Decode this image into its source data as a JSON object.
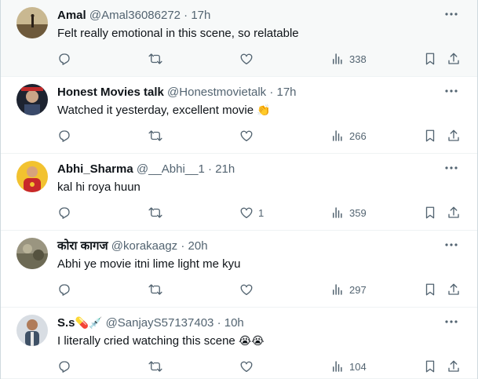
{
  "tweets": [
    {
      "name": "Amal",
      "handle": "@Amal36086272",
      "dot": "·",
      "time": "17h",
      "name_emoji": "",
      "text": "Felt really emotional in this scene, so relatable",
      "text_emoji": "",
      "likes": "",
      "views": "338",
      "avatar_color": "#b8a27a"
    },
    {
      "name": "Honest Movies talk",
      "handle": "@Honestmovietalk",
      "dot": "·",
      "time": "17h",
      "name_emoji": "",
      "text": "Watched it yesterday,  excellent movie",
      "text_emoji": "👏",
      "likes": "",
      "views": "266",
      "avatar_color": "#2c3340"
    },
    {
      "name": "Abhi_Sharma",
      "handle": "@__Abhi__1",
      "dot": "·",
      "time": "21h",
      "name_emoji": "",
      "text": "kal hi roya huun",
      "text_emoji": "",
      "likes": "1",
      "views": "359",
      "avatar_color": "#c8282a"
    },
    {
      "name": "कोरा कागज",
      "handle": "@korakaagz",
      "dot": "·",
      "time": "20h",
      "name_emoji": "",
      "text": "Abhi ye movie itni lime light me kyu",
      "text_emoji": "",
      "likes": "",
      "views": "297",
      "avatar_color": "#8d8a78"
    },
    {
      "name": "S.s",
      "handle": "@SanjayS57137403",
      "dot": "·",
      "time": "10h",
      "name_emoji": "💊💉",
      "text": "I literally cried watching this scene ",
      "text_emoji": "😭😭",
      "likes": "",
      "views": "104",
      "avatar_color": "#6b7b8c"
    }
  ],
  "icons": {
    "reply": "reply-icon",
    "retweet": "retweet-icon",
    "like": "heart-icon",
    "views": "views-icon",
    "bookmark": "bookmark-icon",
    "share": "share-icon",
    "more": "more-icon"
  },
  "colors": {
    "text": "#0f1419",
    "secondary": "#536471",
    "divider": "#eff3f4",
    "hover_bg": "#f7f9f9"
  }
}
